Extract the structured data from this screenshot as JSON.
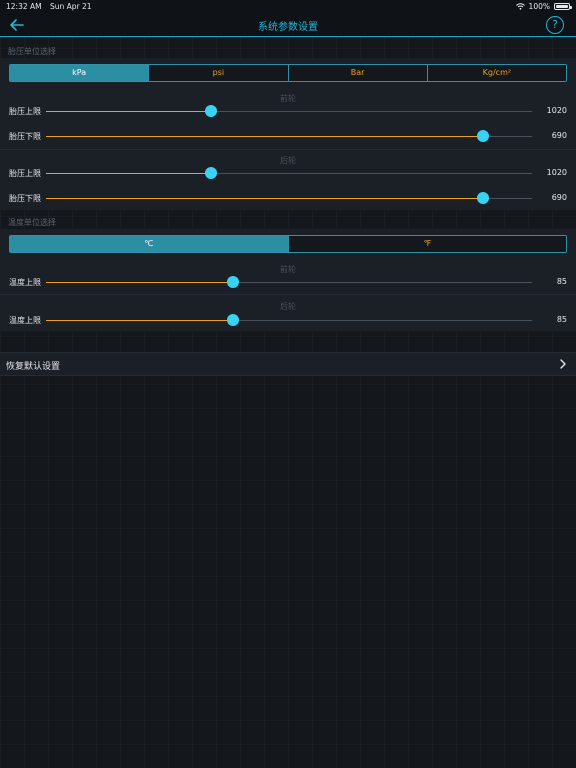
{
  "status_bar": {
    "time": "12:32 AM",
    "date": "Sun Apr 21",
    "battery": "100%",
    "battery_level": 1.0,
    "wifi_icon": "wifi-icon"
  },
  "nav": {
    "title": "系统参数设置",
    "back_icon": "arrow-left-icon",
    "help_icon": "question-circle-icon",
    "help_glyph": "?"
  },
  "pressure": {
    "section_label": "胎压单位选择",
    "units": [
      "kPa",
      "psi",
      "Bar",
      "Kg/cm²"
    ],
    "selected_unit": "kPa",
    "front": {
      "label": "前轮",
      "upper": {
        "label": "胎压上限",
        "value": "1020",
        "fraction": 0.34
      },
      "lower": {
        "label": "胎压下限",
        "value": "690",
        "fraction": 0.9
      }
    },
    "rear": {
      "label": "后轮",
      "upper": {
        "label": "胎压上限",
        "value": "1020",
        "fraction": 0.34
      },
      "lower": {
        "label": "胎压下限",
        "value": "690",
        "fraction": 0.9
      }
    }
  },
  "temperature": {
    "section_label": "温度单位选择",
    "units": [
      "℃",
      "℉"
    ],
    "selected_unit": "℃",
    "front": {
      "label": "前轮",
      "upper": {
        "label": "温度上限",
        "value": "85",
        "fraction": 0.385
      }
    },
    "rear": {
      "label": "后轮",
      "upper": {
        "label": "温度上限",
        "value": "85",
        "fraction": 0.385
      }
    }
  },
  "reset": {
    "label": "恢复默认设置",
    "chevron_icon": "chevron-right-icon"
  },
  "colors": {
    "accent": "#1fb8d6",
    "slider_fill": "#f0a020",
    "thumb": "#38d3f3",
    "segment_selected": "#2c8ea3",
    "background": "#14181d"
  }
}
